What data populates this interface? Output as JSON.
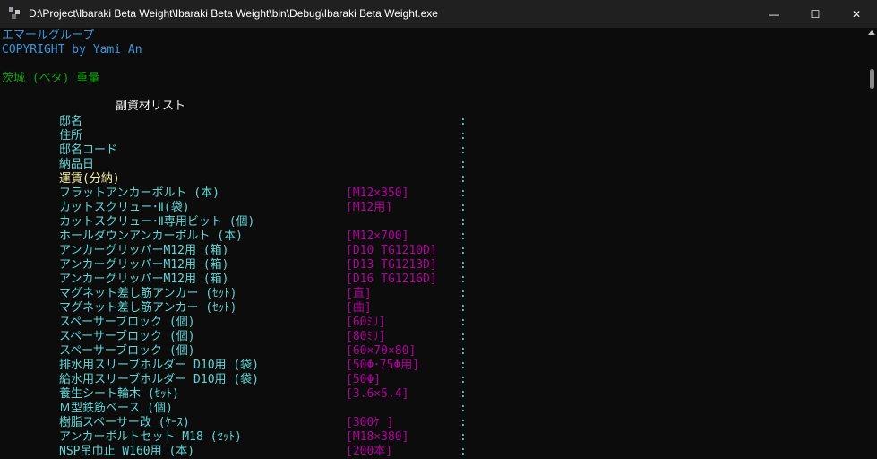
{
  "window": {
    "title": "D:\\Project\\Ibaraki Beta Weight\\Ibaraki Beta Weight\\bin\\Debug\\Ibaraki Beta Weight.exe",
    "minimize_glyph": "—",
    "maximize_glyph": "☐",
    "close_glyph": "✕"
  },
  "header": {
    "company": "エマールグループ",
    "copyright": "COPYRIGHT by Yami An",
    "program": "茨城 (ベタ) 重量"
  },
  "section_title": "副資材リスト",
  "info_fields": [
    {
      "label": "邸名",
      "colon": ":"
    },
    {
      "label": "住所",
      "colon": ":"
    },
    {
      "label": "邸名コード",
      "colon": ":"
    },
    {
      "label": "納品日",
      "colon": ":"
    },
    {
      "label": "運賃(分納)",
      "colon": ":"
    }
  ],
  "items": [
    {
      "name": "フラットアンカーボルト (本)",
      "spec": "[M12×350]",
      "colon": ":"
    },
    {
      "name": "カットスクリュー･Ⅱ(袋)",
      "spec": "[M12用]",
      "colon": ":"
    },
    {
      "name": "カットスクリュー･Ⅱ専用ビット (個)",
      "spec": "",
      "colon": ":"
    },
    {
      "name": "ホールダウンアンカーボルト (本)",
      "spec": "[M12×700]",
      "colon": ":"
    },
    {
      "name": "アンカーグリッパーM12用 (箱)",
      "spec": "[D10 TG1210D]",
      "colon": ":"
    },
    {
      "name": "アンカーグリッパーM12用 (箱)",
      "spec": "[D13 TG1213D]",
      "colon": ":"
    },
    {
      "name": "アンカーグリッパーM12用 (箱)",
      "spec": "[D16 TG1216D]",
      "colon": ":"
    },
    {
      "name": "マグネット差し筋アンカー (ｾｯﾄ)",
      "spec": "[直]",
      "colon": ":"
    },
    {
      "name": "マグネット差し筋アンカー (ｾｯﾄ)",
      "spec": "[曲]",
      "colon": ":"
    },
    {
      "name": "スペーサーブロック (個)",
      "spec": "[60ﾐﾘ]",
      "colon": ":"
    },
    {
      "name": "スペーサーブロック (個)",
      "spec": "[80ﾐﾘ]",
      "colon": ":"
    },
    {
      "name": "スペーサーブロック (個)",
      "spec": "[60×70×80]",
      "colon": ":"
    },
    {
      "name": "排水用スリーブホルダー D10用 (袋)",
      "spec": "[50Φ･75Φ用]",
      "colon": ":"
    },
    {
      "name": "給水用スリーブホルダー D10用 (袋)",
      "spec": "[50Φ]",
      "colon": ":"
    },
    {
      "name": "養生シート輪木 (ｾｯﾄ)",
      "spec": "[3.6×5.4]",
      "colon": ":"
    },
    {
      "name": "Ｍ型鉄筋ベース (個)",
      "spec": "",
      "colon": ":"
    },
    {
      "name": "樹脂スペーサー改 (ｹｰｽ)",
      "spec": "[300ｹ ]",
      "colon": ":"
    },
    {
      "name": "アンカーボルトセット M18 (ｾｯﾄ)",
      "spec": "[M18×380]",
      "colon": ":"
    },
    {
      "name": "NSP吊巾止 W160用 (本)",
      "spec": "[200本]",
      "colon": ":"
    }
  ]
}
